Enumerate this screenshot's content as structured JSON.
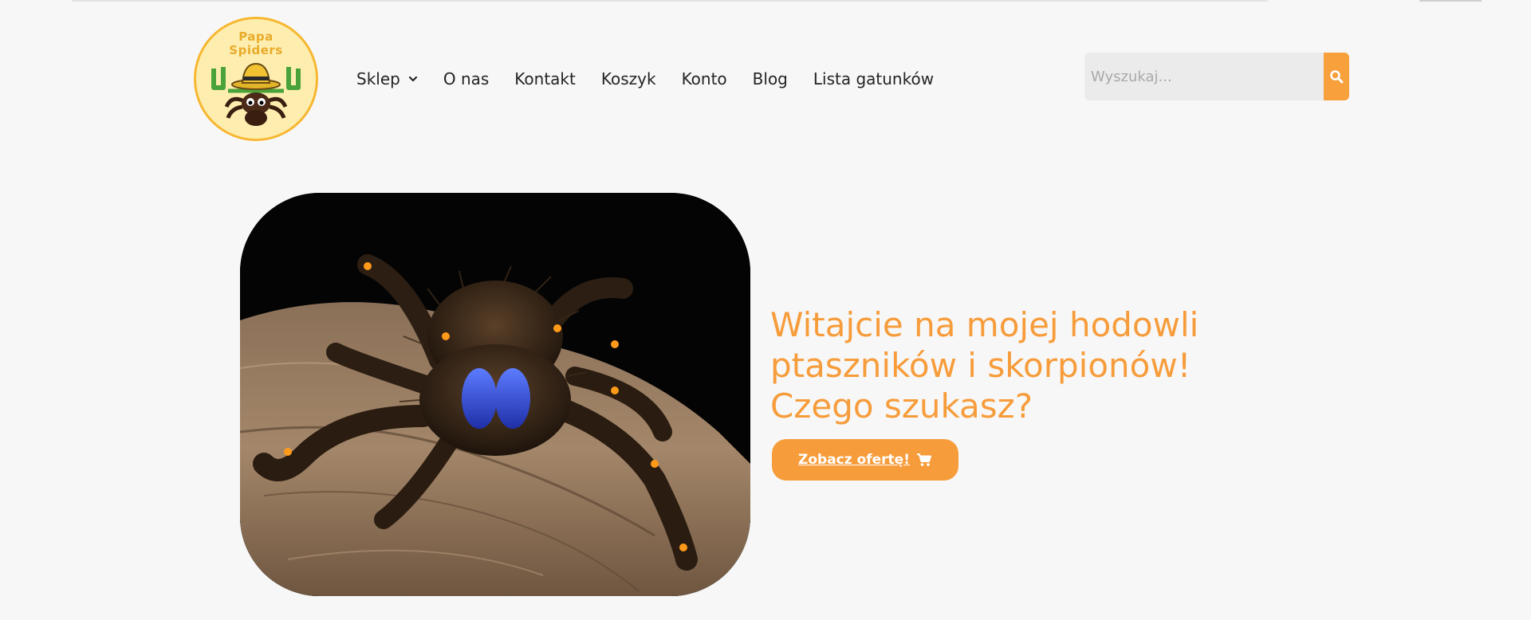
{
  "logo": {
    "line1": "Papa",
    "line2": "Spiders"
  },
  "nav": {
    "items": [
      {
        "label": "Sklep",
        "has_dropdown": true
      },
      {
        "label": "O nas"
      },
      {
        "label": "Kontakt"
      },
      {
        "label": "Koszyk"
      },
      {
        "label": "Konto"
      },
      {
        "label": "Blog"
      },
      {
        "label": "Lista gatunków"
      }
    ]
  },
  "search": {
    "placeholder": "Wyszukaj..."
  },
  "hero": {
    "title": "Witajcie na mojej hodowli ptaszników i skorpionów! Czego szukasz?",
    "cta_label": "Zobacz ofertę!"
  },
  "colors": {
    "accent": "#f79c3a",
    "background": "#f7f7f7",
    "search_bg": "#ebebeb",
    "text": "#242424"
  },
  "icons": {
    "search": "search-icon",
    "cart": "cart-icon",
    "dropdown": "chevron-down-icon"
  }
}
